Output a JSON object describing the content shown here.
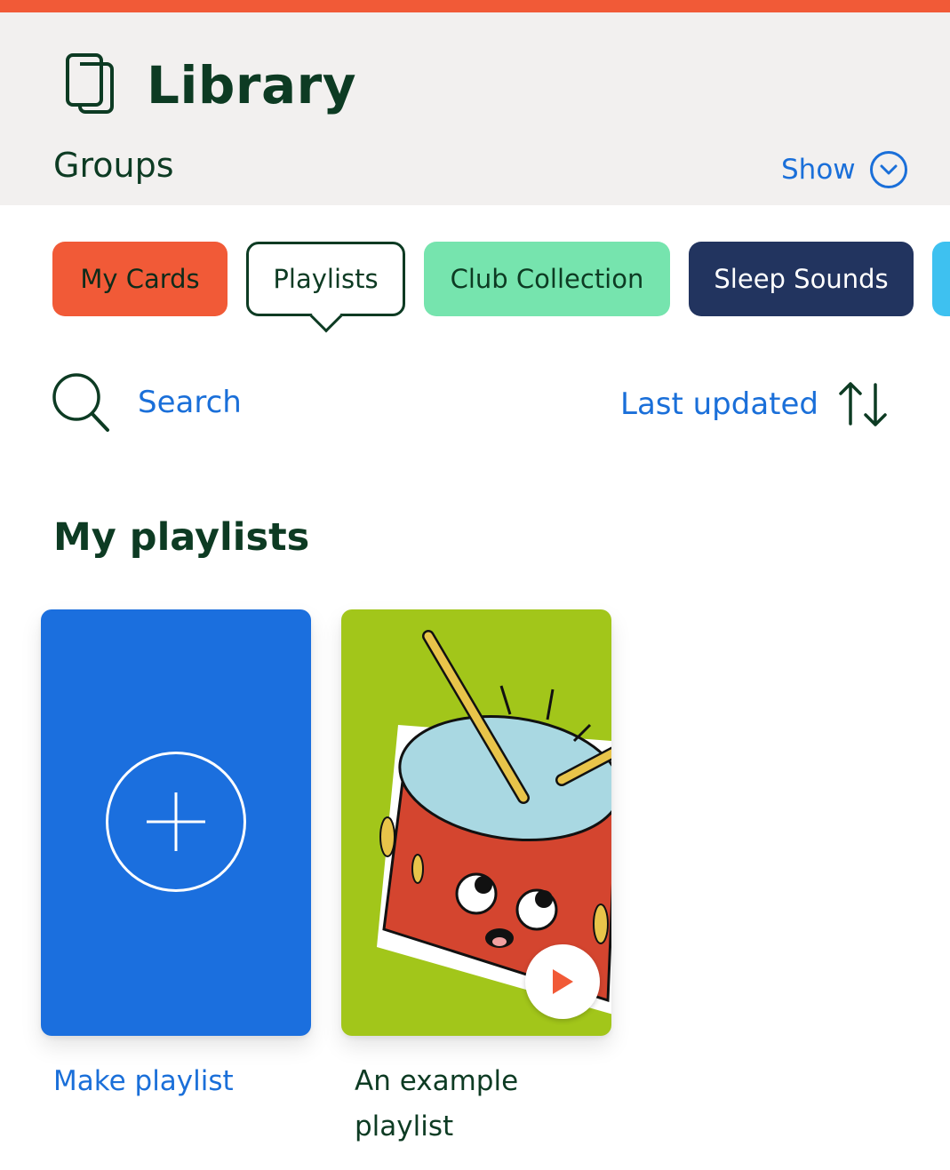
{
  "header": {
    "title": "Library",
    "groups_label": "Groups",
    "show_label": "Show"
  },
  "tabs": [
    {
      "label": "My Cards",
      "color": "#f15a37"
    },
    {
      "label": "Playlists",
      "selected": true
    },
    {
      "label": "Club Collection",
      "color": "#76e4ae"
    },
    {
      "label": "Sleep Sounds",
      "color": "#22345f"
    }
  ],
  "search": {
    "label": "Search"
  },
  "sort": {
    "label": "Last updated"
  },
  "section": {
    "title": "My playlists"
  },
  "cards": [
    {
      "label": "Make playlist",
      "color": "#1b6fde"
    },
    {
      "label": "An example playlist",
      "color": "#a2c61a"
    }
  ],
  "colors": {
    "accent_blue": "#1a6fd9",
    "dark_green": "#0d3b23",
    "brand_orange": "#f15a37"
  }
}
